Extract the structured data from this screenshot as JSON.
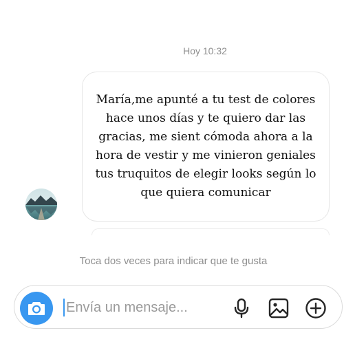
{
  "thread": {
    "timestamp": "Hoy 10:32",
    "message": {
      "lines": [
        "María,me apunté a tu test de colores",
        "hace unos días y te quiero dar las",
        "gracias, me sient cómoda ahora a la",
        "hora de vestir y me vinieron geniales",
        "tus truquitos de elegir looks según lo",
        "que quiera comunicar"
      ]
    },
    "like_hint": "Toca dos veces para indicar que te gusta"
  },
  "composer": {
    "placeholder": "Envía un mensaje...",
    "accent_color": "#3897f0"
  },
  "icons": {
    "camera": "camera-icon",
    "mic": "microphone-icon",
    "gallery": "image-icon",
    "add": "plus-circle-icon",
    "avatar": "avatar-lake-photo"
  }
}
